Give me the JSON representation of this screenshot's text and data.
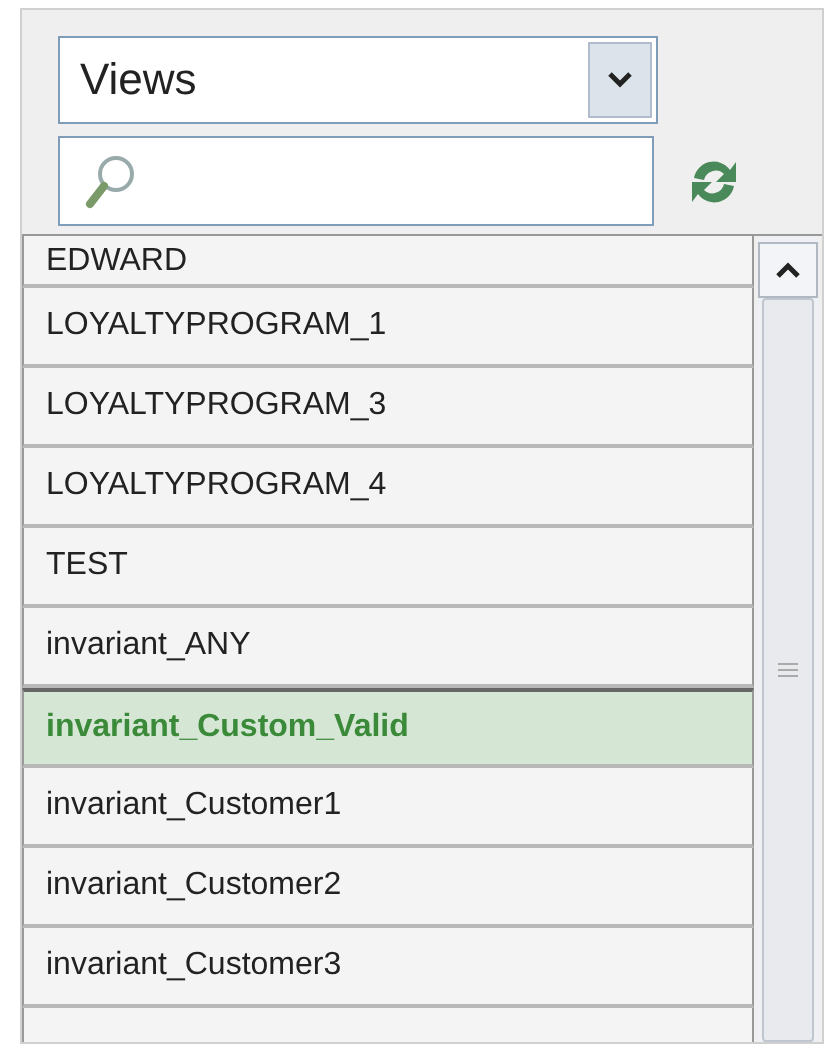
{
  "view_select": {
    "value": "Views"
  },
  "list": [
    {
      "label": "EDWARD",
      "selected": false
    },
    {
      "label": "LOYALTYPROGRAM_1",
      "selected": false
    },
    {
      "label": "LOYALTYPROGRAM_3",
      "selected": false
    },
    {
      "label": "LOYALTYPROGRAM_4",
      "selected": false
    },
    {
      "label": "TEST",
      "selected": false
    },
    {
      "label": "invariant_ANY",
      "selected": false
    },
    {
      "label": "invariant_Custom_Valid",
      "selected": true
    },
    {
      "label": "invariant_Customer1",
      "selected": false
    },
    {
      "label": "invariant_Customer2",
      "selected": false
    },
    {
      "label": "invariant_Customer3",
      "selected": false
    }
  ]
}
